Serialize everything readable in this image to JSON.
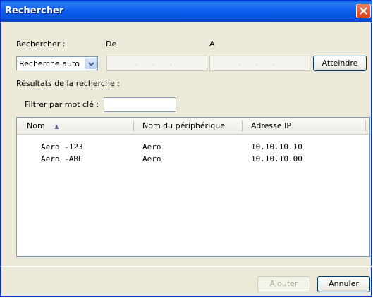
{
  "window": {
    "title": "Rechercher"
  },
  "search": {
    "label": "Rechercher :",
    "from_label": "De",
    "to_label": "A",
    "mode_value": "Recherche auto",
    "from_ip_placeholder": ". . .",
    "to_ip_placeholder": ". . .",
    "goto_button": "Atteindre"
  },
  "results": {
    "label": "Résultats de la recherche :",
    "filter_label": "Filtrer par mot clé :",
    "filter_value": "",
    "columns": [
      "Nom",
      "Nom du périphérique",
      "Adresse IP"
    ],
    "sort_indicator": "▲",
    "rows": [
      [
        "Aero -123",
        "Aero",
        "10.10.10.10"
      ],
      [
        "Aero -ABC",
        "Aero",
        "10.10.10.00"
      ]
    ]
  },
  "footer": {
    "add_button": "Ajouter",
    "cancel_button": "Annuler"
  },
  "icons": {
    "close": "close-icon",
    "dropdown": "chevron-down-icon",
    "sort": "sort-ascending-icon"
  },
  "colors": {
    "titlebar": "#0a5ae4",
    "close": "#d9411a",
    "dialog_bg": "#ece9d8"
  }
}
